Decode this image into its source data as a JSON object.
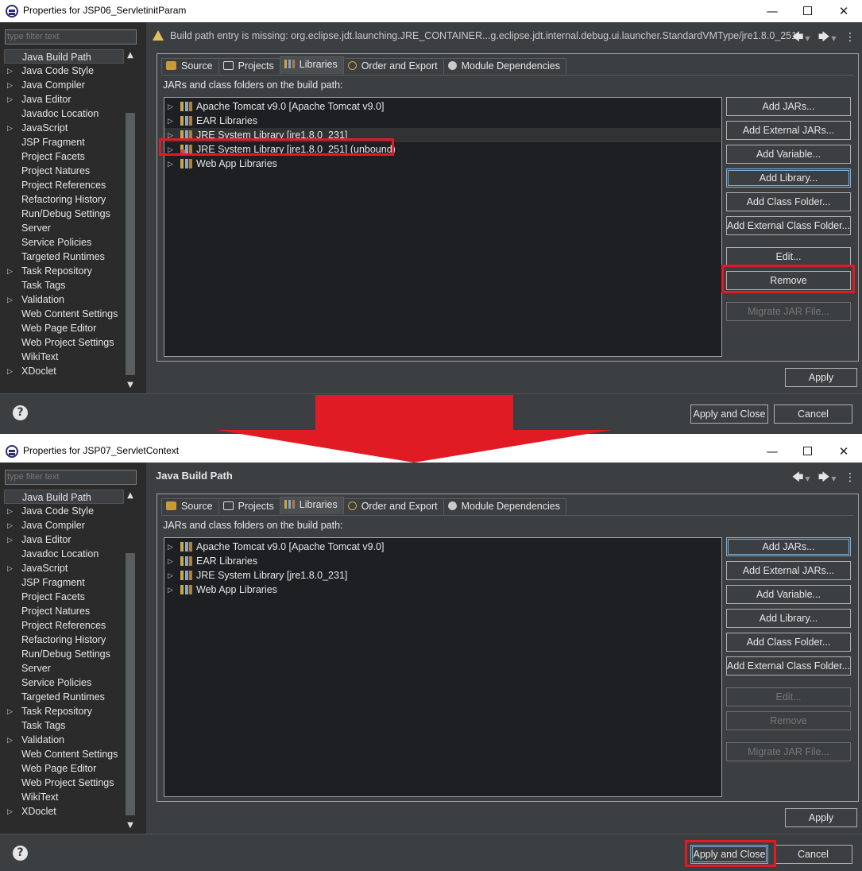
{
  "window1": {
    "title": "Properties for JSP06_ServletinitParam",
    "message": "Build path entry is missing: org.eclipse.jdt.launching.JRE_CONTAINER...g.eclipse.jdt.internal.debug.ui.launcher.StandardVMType/jre1.8.0_251",
    "libraries": [
      "Apache Tomcat v9.0 [Apache Tomcat v9.0]",
      "EAR Libraries",
      "JRE System Library [jre1.8.0_231]",
      "JRE System Library [jre1.8.0_251] (unbound)",
      "Web App Libraries"
    ]
  },
  "window2": {
    "title": "Properties for JSP07_ServletContext",
    "page_title": "Java Build Path",
    "libraries": [
      "Apache Tomcat v9.0 [Apache Tomcat v9.0]",
      "EAR Libraries",
      "JRE System Library [jre1.8.0_231]",
      "Web App Libraries"
    ]
  },
  "common": {
    "filter_placeholder": "type filter text",
    "description": "JARs and class folders on the build path:",
    "tabs": [
      "Source",
      "Projects",
      "Libraries",
      "Order and Export",
      "Module Dependencies"
    ],
    "tree_items": [
      "Java Build Path",
      "Java Code Style",
      "Java Compiler",
      "Java Editor",
      "Javadoc Location",
      "JavaScript",
      "JSP Fragment",
      "Project Facets",
      "Project Natures",
      "Project References",
      "Refactoring History",
      "Run/Debug Settings",
      "Server",
      "Service Policies",
      "Targeted Runtimes",
      "Task Repository",
      "Task Tags",
      "Validation",
      "Web Content Settings",
      "Web Page Editor",
      "Web Project Settings",
      "WikiText",
      "XDoclet"
    ],
    "buttons": {
      "add_jars": "Add JARs...",
      "add_external_jars": "Add External JARs...",
      "add_variable": "Add Variable...",
      "add_library": "Add Library...",
      "add_class_folder": "Add Class Folder...",
      "add_external_class_folder": "Add External Class Folder...",
      "edit": "Edit...",
      "remove": "Remove",
      "migrate": "Migrate JAR File...",
      "apply": "Apply",
      "apply_and_close": "Apply and Close",
      "cancel": "Cancel"
    },
    "window_controls": {
      "minimize": "—",
      "close": "✕"
    },
    "help": "?"
  },
  "colors": {
    "highlight_red": "#e01b24",
    "dark_bg": "#3c3f41",
    "tree_bg": "#2b2b2b",
    "focus_blue": "#7ab1e0"
  },
  "icons": [
    "eclipse-app-icon",
    "warning-icon",
    "back-arrow-icon",
    "forward-arrow-icon",
    "more-menu-icon",
    "library-icon",
    "help-icon"
  ]
}
